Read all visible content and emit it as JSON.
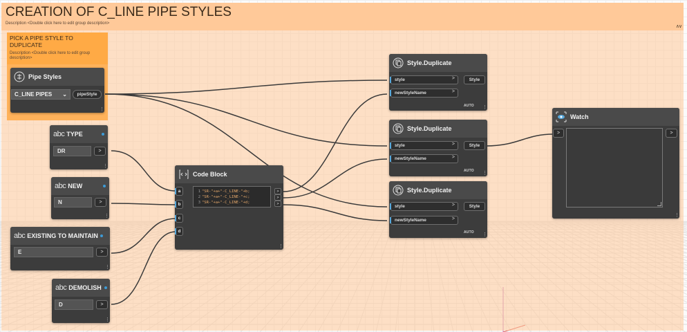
{
  "workspace": {
    "group_main": {
      "title": "CREATION OF C_LINE PIPE STYLES",
      "description": "Description <Double click here to edit group description>",
      "color": "#ffc999"
    },
    "group_pick": {
      "title": "PICK A PIPE STYLE TO DUPLICATE",
      "description": "Description <Double click here to edit group description>",
      "color": "#ffaa45"
    }
  },
  "nodes": {
    "pipe_styles": {
      "title": "Pipe Styles",
      "icon": "pipe-styles-icon",
      "selected": "C_LINE PIPES",
      "output": "pipeStyle"
    },
    "string_type": {
      "title": "TYPE",
      "value": "DR"
    },
    "string_new": {
      "title": "NEW",
      "value": "N"
    },
    "string_existing": {
      "title": "EXISTING TO MAINTAIN",
      "value": "E"
    },
    "string_demolish": {
      "title": "DEMOLISH",
      "value": "D"
    },
    "code_block": {
      "title": "Code Block",
      "icon": "code-block-icon",
      "inputs": [
        "a",
        "b",
        "c",
        "d"
      ],
      "lines": [
        {
          "num": "1",
          "code": "\"SR-\"+a+\"-C_LINE-\"+b;"
        },
        {
          "num": "2",
          "code": "\"SR-\"+a+\"-C_LINE-\"+c;"
        },
        {
          "num": "3",
          "code": "\"SR-\"+a+\"-C_LINE-\"+d;"
        }
      ]
    },
    "style_duplicate": [
      {
        "title": "Style.Duplicate",
        "input1": "style",
        "input2": "newStyleName",
        "output": "Style",
        "lacing": "AUTO"
      },
      {
        "title": "Style.Duplicate",
        "input1": "style",
        "input2": "newStyleName",
        "output": "Style",
        "lacing": "AUTO"
      },
      {
        "title": "Style.Duplicate",
        "input1": "style",
        "input2": "newStyleName",
        "output": "Style",
        "lacing": "AUTO"
      }
    ],
    "watch": {
      "title": "Watch",
      "icon": "eye-icon"
    }
  },
  "text_prefix": "abc",
  "port_arrow": ">",
  "wire_color": "#3a3a3a",
  "accent_color": "#58a9dd"
}
